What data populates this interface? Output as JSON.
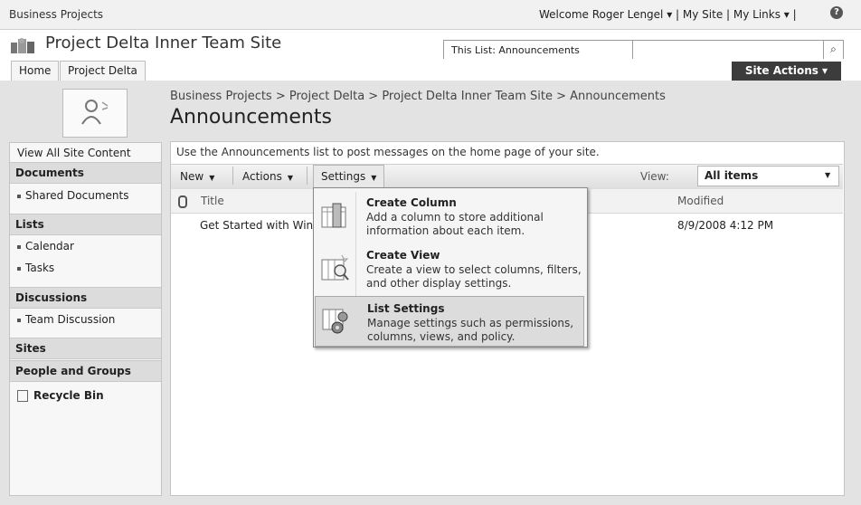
{
  "topbar": {
    "breadcrumb": "Business Projects",
    "welcome": "Welcome Roger Lengel ▾  |  My Site  |  My Links ▾  |",
    "help": "?"
  },
  "header": {
    "site_title": "Project Delta Inner Team Site",
    "scope_value": "This List: Announcements",
    "search_placeholder": "",
    "search_icon": "⌕",
    "tabs": [
      "Home",
      "Project Delta"
    ],
    "site_actions": "Site Actions ▾"
  },
  "page": {
    "breadcrumb": "Business Projects > Project Delta > Project Delta Inner Team Site > Announcements",
    "title": "Announcements",
    "description": "Use the Announcements list to post messages on the home page of your site."
  },
  "leftnav": {
    "view_all": "View All Site Content",
    "documents": "Documents",
    "shared_documents": "Shared Documents",
    "lists": "Lists",
    "calendar": "Calendar",
    "tasks": "Tasks",
    "discussions": "Discussions",
    "team_discussion": "Team Discussion",
    "sites": "Sites",
    "people": "People and Groups",
    "recycle": "Recycle Bin"
  },
  "toolbar": {
    "new": "New",
    "actions": "Actions",
    "settings": "Settings",
    "view_label": "View:",
    "view_value": "All items"
  },
  "list": {
    "col_title": "Title",
    "col_modified": "Modified",
    "row_title": "Get Started with Windows SharePoint Services!",
    "row_modified": "8/9/2008 4:12 PM"
  },
  "settings_menu": {
    "items": [
      {
        "title": "Create Column",
        "desc": "Add a column to store additional information about each item."
      },
      {
        "title": "Create View",
        "desc": "Create a view to select columns, filters, and other display settings."
      },
      {
        "title": "List Settings",
        "desc": "Manage settings such as permissions, columns, views, and policy."
      }
    ]
  }
}
